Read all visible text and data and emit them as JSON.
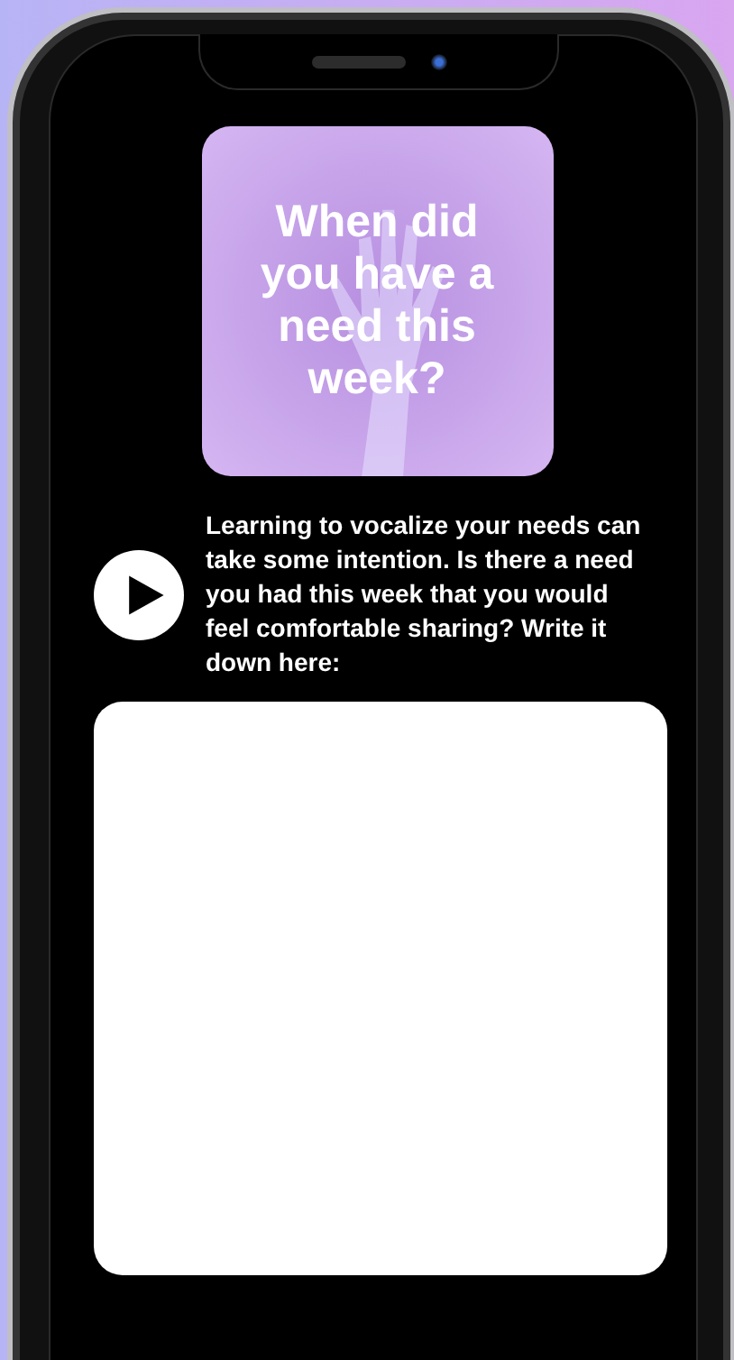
{
  "card": {
    "title": "When did you have a need this week?"
  },
  "prompt": {
    "text": "Learning to vocalize your needs can take some intention. Is there a need you had this week that you would feel comfortable sharing? Write it down here:"
  }
}
